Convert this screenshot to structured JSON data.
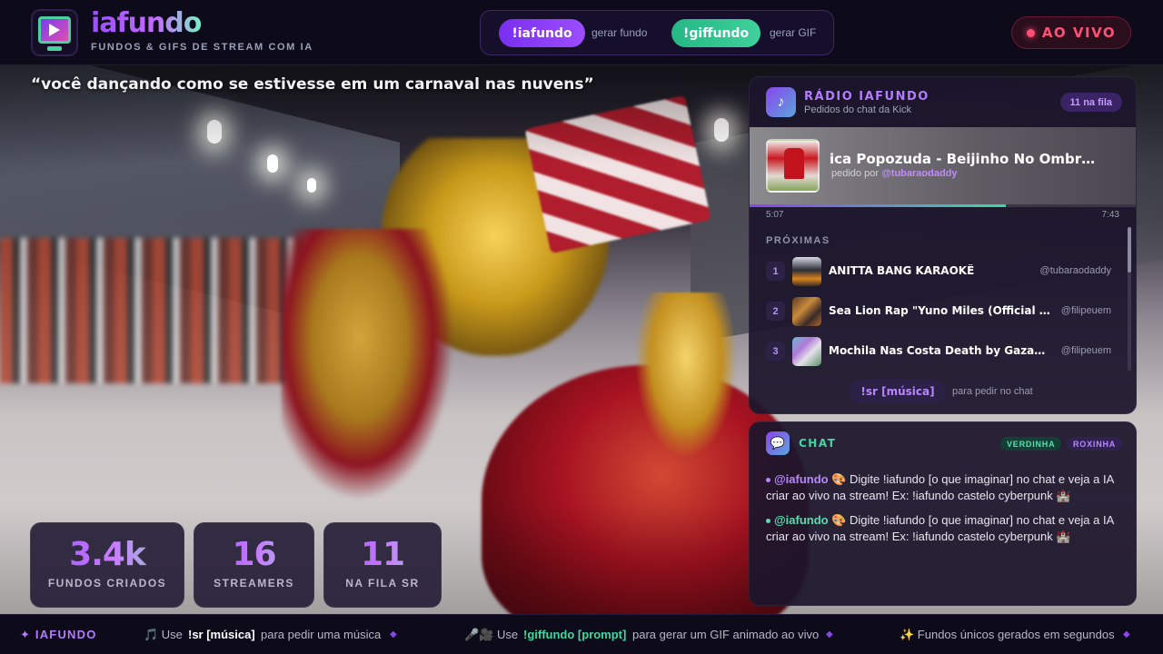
{
  "header": {
    "brand_name": "iafundo",
    "brand_tagline": "FUNDOS & GIFS DE STREAM COM IA",
    "commands": [
      {
        "label": "!iafundo",
        "desc": "gerar fundo"
      },
      {
        "label": "!giffundo",
        "desc": "gerar GIF"
      }
    ],
    "live_label": "AO VIVO"
  },
  "prompt": "“você dançando como se estivesse em um carnaval nas nuvens”",
  "stats": [
    {
      "value": "3.4k",
      "label": "FUNDOS CRIADOS"
    },
    {
      "value": "16",
      "label": "STREAMERS"
    },
    {
      "value": "11",
      "label": "NA FILA SR"
    }
  ],
  "radio": {
    "title": "RÁDIO IAFUNDO",
    "subtitle": "Pedidos do chat da Kick",
    "queue_badge": "11 na fila",
    "now_playing": {
      "title": "ica Popozuda - Beijinho No Ombro (O...",
      "requested_prefix": "pedido por",
      "requested_by": "@tubaraodaddy",
      "current_time": "5:07",
      "total_time": "7:43",
      "progress": 0.66
    },
    "next_label": "PRÓXIMAS",
    "queue": [
      {
        "num": "1",
        "title": "ANITTA BANG KARAOKÊ",
        "user": "@tubaraodaddy"
      },
      {
        "num": "2",
        "title": "Sea Lion Rap \"Yuno Miles (Official Vid...",
        "user": "@filipeuem"
      },
      {
        "num": "3",
        "title": "Mochila Nas Costa Death by Gazamour...",
        "user": "@filipeuem"
      }
    ],
    "sr_command": "!sr [música]",
    "sr_hint": "para pedir no chat"
  },
  "chat": {
    "title": "CHAT",
    "tags": [
      "VERDINHA",
      "ROXINHA"
    ],
    "messages": [
      {
        "user": "@iafundo",
        "text": " 🎨 Digite !iafundo [o que imaginar] no chat e veja a IA criar ao vivo na stream! Ex: !iafundo castelo cyberpunk 🏰",
        "user_color": "#b986ff"
      },
      {
        "user": "@iafundo",
        "text": " 🎨 Digite !iafundo [o que imaginar] no chat e veja a IA criar ao vivo na stream! Ex: !iafundo castelo cyberpunk 🏰",
        "user_color": "#56dfac"
      }
    ]
  },
  "ticker": {
    "brand": "✦ IAFUNDO",
    "item1_pre": "🎵 Use",
    "item1_cmd": "!sr [música]",
    "item1_post": "para pedir uma música",
    "item2_pre": "🎤🎥 Use",
    "item2_cmd": "!giffundo [prompt]",
    "item2_post": "para gerar um GIF animado ao vivo",
    "item3": "✨ Fundos únicos gerados em segundos",
    "separator": "◆"
  },
  "icons": {
    "logo": "monitor-play-icon",
    "radio": "music-note-icon",
    "chat": "chat-bubble-icon",
    "live": "live-dot-icon"
  },
  "colors": {
    "accent_purple": "#9b4dff",
    "accent_green": "#42d6a0",
    "live_red": "#ff4f74",
    "background": "#0d0a1a"
  }
}
